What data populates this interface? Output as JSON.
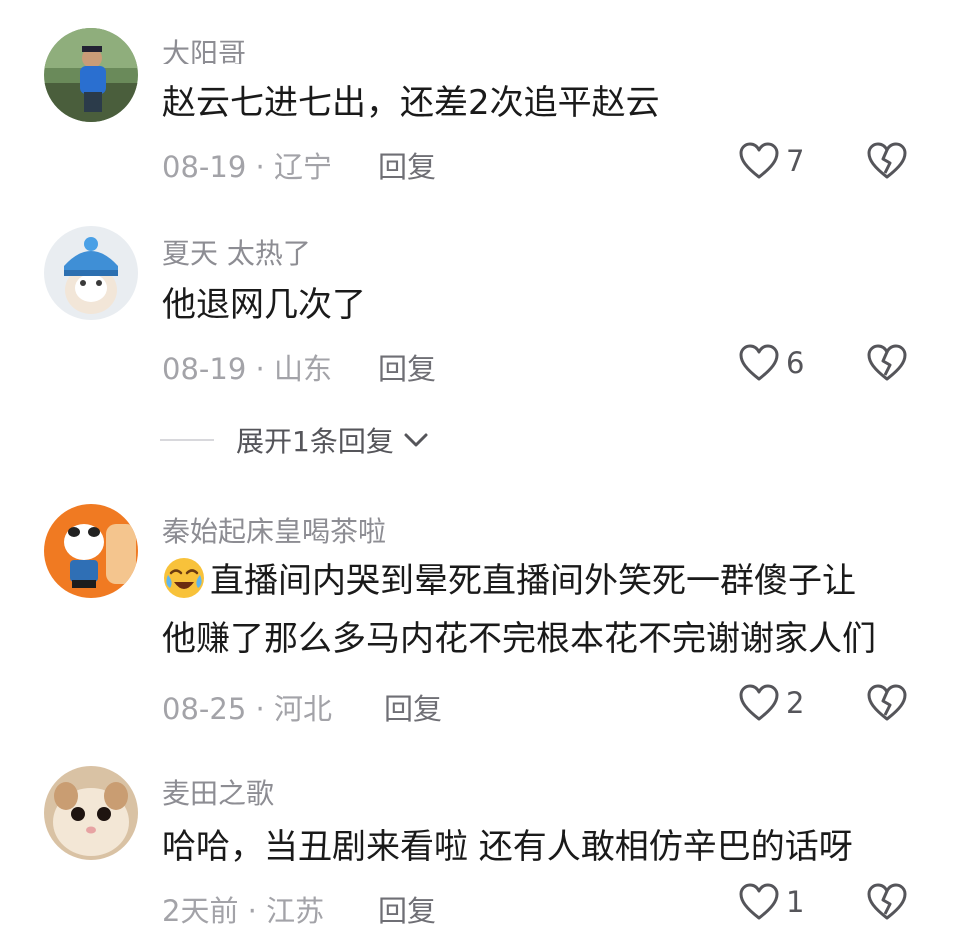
{
  "comments": [
    {
      "username": "大阳哥",
      "text": "赵云七进七出，还差2次追平赵云",
      "date": "08-19",
      "location": "辽宁",
      "reply_label": "回复",
      "likes": "7"
    },
    {
      "username": "夏天 太热了",
      "text": "他退网几次了",
      "date": "08-19",
      "location": "山东",
      "reply_label": "回复",
      "likes": "6"
    },
    {
      "username": "秦始起床皇喝茶啦",
      "text_line1": "直播间内哭到晕死直播间外笑死一群傻子让",
      "text_line2": "他赚了那么多马内花不完根本花不完谢谢家人们",
      "emoji": "crying-laughing-emoji",
      "date": "08-25",
      "location": "河北",
      "reply_label": "回复",
      "likes": "2"
    },
    {
      "username": "麦田之歌",
      "text": "哈哈，当丑剧来看啦  还有人敢相仿辛巴的话呀",
      "date": "2天前",
      "location": "江苏",
      "reply_label": "回复",
      "likes": "1"
    }
  ],
  "meta_separator": " · ",
  "expand_replies": {
    "label": "展开1条回复",
    "icon": "chevron-down-icon"
  },
  "icons": {
    "like": "heart-outline-icon",
    "dislike": "broken-heart-icon"
  },
  "colors": {
    "username": "#8d8d93",
    "text": "#1a1a1a",
    "meta": "#a3a3a8"
  }
}
